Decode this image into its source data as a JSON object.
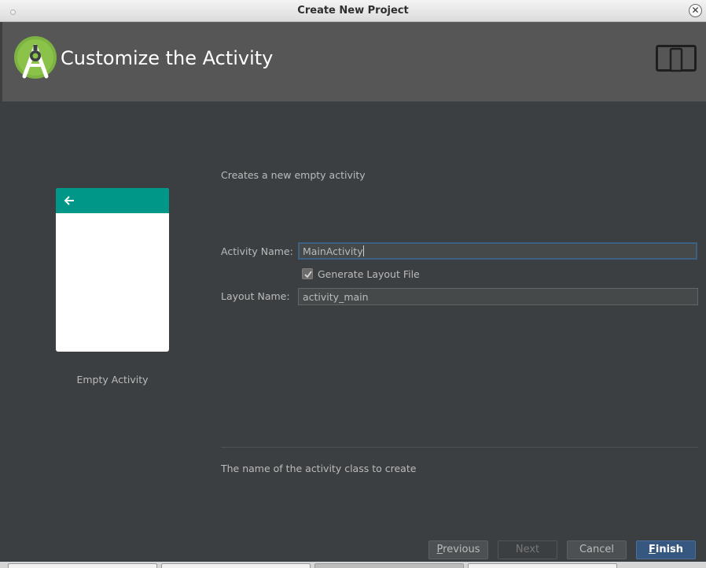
{
  "window": {
    "title": "Create New Project"
  },
  "header": {
    "title": "Customize the Activity",
    "logo_icon": "android-studio-logo",
    "device_icon": "phone-tablet-icon",
    "background": "#565656"
  },
  "template": {
    "name": "Empty Activity",
    "appbar_color": "#009688"
  },
  "description": "Creates a new empty activity",
  "form": {
    "activity_name_label": "Activity Name:",
    "activity_name_value": "MainActivity",
    "generate_layout_label": "Generate Layout File",
    "generate_layout_checked": true,
    "layout_name_label": "Layout Name:",
    "layout_name_value": "activity_main"
  },
  "help_text": "The name of the activity class to create",
  "buttons": {
    "previous_mnemonic": "P",
    "previous_rest": "revious",
    "next": "Next",
    "cancel": "Cancel",
    "finish_mnemonic": "F",
    "finish_rest": "inish"
  }
}
